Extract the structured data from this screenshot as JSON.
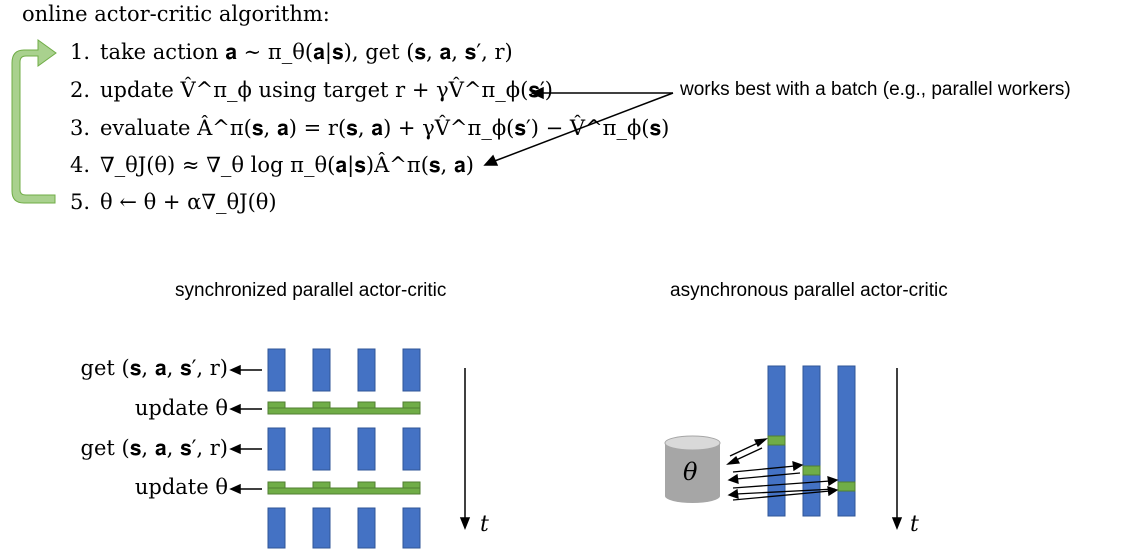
{
  "algorithm": {
    "title": "online actor-critic algorithm:",
    "steps": [
      {
        "num": "1.",
        "text": "take action 𝐚 ∼ π_θ(𝐚|𝐬), get (𝐬, 𝐚, 𝐬′, r)"
      },
      {
        "num": "2.",
        "text": "update V̂^π_ϕ using target r + γV̂^π_ϕ(𝐬′)"
      },
      {
        "num": "3.",
        "text": "evaluate Â^π(𝐬, 𝐚) = r(𝐬, 𝐚) + γV̂^π_ϕ(𝐬′) − V̂^π_ϕ(𝐬)"
      },
      {
        "num": "4.",
        "text": "∇_θJ(θ) ≈ ∇_θ log π_θ(𝐚|𝐬)Â^π(𝐬, 𝐚)"
      },
      {
        "num": "5.",
        "text": "θ ← θ + α∇_θJ(θ)"
      }
    ],
    "annotation": "works best with a batch (e.g., parallel workers)"
  },
  "sync": {
    "title": "synchronized parallel actor-critic",
    "rows": [
      {
        "label": "get (𝐬, 𝐚, 𝐬′, r)"
      },
      {
        "label": "update θ"
      },
      {
        "label": "get (𝐬, 𝐚, 𝐬′, r)"
      },
      {
        "label": "update θ"
      }
    ],
    "time_label": "t"
  },
  "async": {
    "title": "asynchronous parallel actor-critic",
    "server_label": "θ",
    "time_label": "t"
  },
  "colors": {
    "worker_blue": "#4472c4",
    "update_green": "#70ad47",
    "loop_arrow_green": "#a9d18e",
    "cylinder_gray": "#a6a6a6"
  }
}
